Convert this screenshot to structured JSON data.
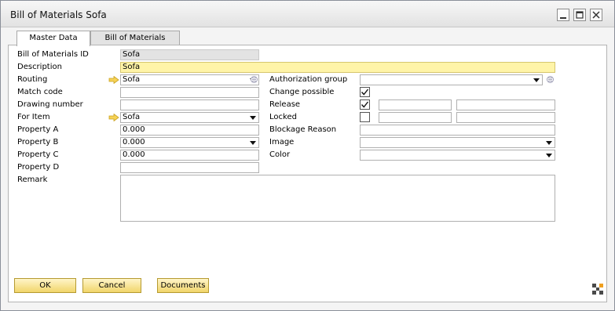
{
  "window": {
    "title": "Bill of Materials Sofa"
  },
  "tabs": [
    "Master Data",
    "Bill of Materials"
  ],
  "left_fields": [
    {
      "label": "Bill of Materials ID",
      "value": "Sofa"
    },
    {
      "label": "Description",
      "value": "Sofa"
    },
    {
      "label": "Routing",
      "value": "Sofa"
    },
    {
      "label": "Match code",
      "value": ""
    },
    {
      "label": "Drawing number",
      "value": ""
    },
    {
      "label": "For Item",
      "value": "Sofa"
    },
    {
      "label": "Property A",
      "value": "0.000"
    },
    {
      "label": "Property B",
      "value": "0.000"
    },
    {
      "label": "Property C",
      "value": "0.000"
    },
    {
      "label": "Property D",
      "value": ""
    },
    {
      "label": "Remark",
      "value": ""
    }
  ],
  "right_fields": [
    {
      "label": "Authorization group",
      "value": ""
    },
    {
      "label": "Change possible",
      "checked": true
    },
    {
      "label": "Release",
      "checked": true
    },
    {
      "label": "Locked",
      "checked": false
    },
    {
      "label": "Blockage Reason",
      "value": ""
    },
    {
      "label": "Image",
      "value": ""
    },
    {
      "label": "Color",
      "value": ""
    }
  ],
  "buttons": {
    "ok": "OK",
    "cancel": "Cancel",
    "documents": "Documents"
  }
}
